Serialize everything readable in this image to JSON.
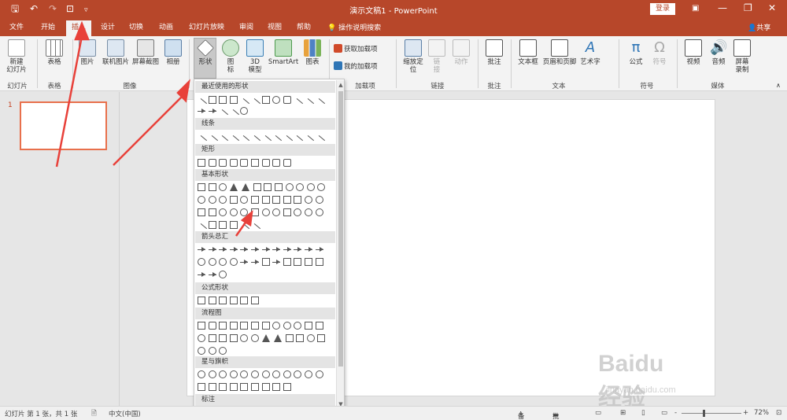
{
  "titlebar": {
    "doc_title": "演示文稿1  -  PowerPoint",
    "login_label": "登录",
    "colors": {
      "accent": "#b7472a"
    },
    "qa_icons": [
      "save-icon",
      "undo-icon",
      "redo-icon",
      "customize-icon",
      "dropdown-icon"
    ],
    "win_icons": [
      "ribbon-display-icon",
      "minimize-icon",
      "restore-icon",
      "close-icon"
    ]
  },
  "tabs": [
    "文件",
    "开始",
    "插入",
    "设计",
    "切换",
    "动画",
    "幻灯片放映",
    "审阅",
    "视图",
    "帮助"
  ],
  "active_tab": "插入",
  "tell_me": "操作说明搜索",
  "share": "共享",
  "ribbon": {
    "slides": {
      "new_slide_l1": "新建",
      "new_slide_l2": "幻灯片",
      "group": "幻灯片"
    },
    "tables": {
      "table": "表格",
      "group": "表格"
    },
    "images": {
      "picture": "图片",
      "online_picture": "联机图片",
      "screenshot": "屏幕截图",
      "album": "相册",
      "group": "图像"
    },
    "illustrations": {
      "shapes": "形状",
      "icons_l1": "图",
      "icons_l2": "标",
      "model_l1": "3D",
      "model_l2": "模型",
      "smartart": "SmartArt",
      "chart": "图表"
    },
    "addins": {
      "get": "获取加载项",
      "mine": "我的加载项",
      "group": "加载项"
    },
    "links": {
      "zoom_l1": "缩放定",
      "zoom_l2": "位",
      "link_l1": "链",
      "link_l2": "接",
      "action": "动作",
      "group": "链接"
    },
    "comments": {
      "comment": "批注",
      "group": "批注"
    },
    "text": {
      "textbox": "文本框",
      "header_footer": "页眉和页脚",
      "wordart": "艺术字",
      "group": "文本"
    },
    "symbols": {
      "equation": "公式",
      "symbol": "符号",
      "group": "符号"
    },
    "media": {
      "video": "视频",
      "audio": "音频",
      "record_l1": "屏幕",
      "record_l2": "录制",
      "group": "媒体"
    }
  },
  "thumbnails": {
    "number": "1"
  },
  "gallery": {
    "sections": [
      "最近使用的形状",
      "线条",
      "矩形",
      "基本形状",
      "箭头总汇",
      "公式形状",
      "流程图",
      "星与旗帜",
      "标注"
    ]
  },
  "statusbar": {
    "slide_info": "幻灯片 第 1 张，共 1 张",
    "language": "中文(中国)",
    "notes": "备注",
    "comments": "批注",
    "zoom": "72%",
    "zoom_minus": "-",
    "zoom_plus": "+"
  },
  "watermark": {
    "brand": "Baidu经验",
    "url": "jingyan.baidu.com"
  }
}
